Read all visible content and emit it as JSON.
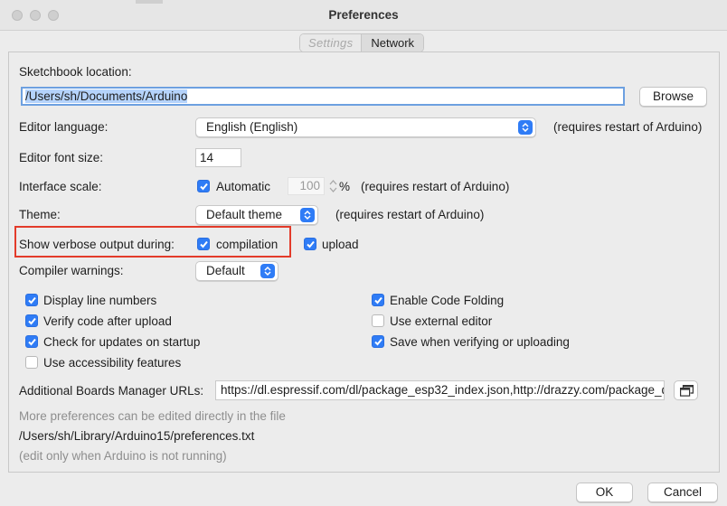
{
  "window": {
    "title": "Preferences"
  },
  "tabs": [
    {
      "label": "Settings",
      "active": true
    },
    {
      "label": "Network",
      "active": false
    }
  ],
  "sketchbook": {
    "label": "Sketchbook location:",
    "path": "/Users/sh/Documents/Arduino",
    "browse_label": "Browse"
  },
  "editor_language": {
    "label": "Editor language:",
    "value": "English (English)",
    "note": "(requires restart of Arduino)"
  },
  "editor_font_size": {
    "label": "Editor font size:",
    "value": "14"
  },
  "interface_scale": {
    "label": "Interface scale:",
    "automatic_label": "Automatic",
    "automatic_checked": true,
    "value": "100",
    "unit": "%",
    "note": "(requires restart of Arduino)"
  },
  "theme": {
    "label": "Theme:",
    "value": "Default theme",
    "note": "(requires restart of Arduino)"
  },
  "verbose": {
    "label": "Show verbose output during:",
    "compilation_label": "compilation",
    "compilation_checked": true,
    "upload_label": "upload",
    "upload_checked": true
  },
  "compiler_warnings": {
    "label": "Compiler warnings:",
    "value": "Default"
  },
  "options": {
    "display_line_numbers": {
      "label": "Display line numbers",
      "checked": true
    },
    "verify_after_upload": {
      "label": "Verify code after upload",
      "checked": true
    },
    "check_updates": {
      "label": "Check for updates on startup",
      "checked": true
    },
    "accessibility": {
      "label": "Use accessibility features",
      "checked": false
    },
    "code_folding": {
      "label": "Enable Code Folding",
      "checked": true
    },
    "external_editor": {
      "label": "Use external editor",
      "checked": false
    },
    "save_on_verify": {
      "label": "Save when verifying or uploading",
      "checked": true
    }
  },
  "boards_manager": {
    "label": "Additional Boards Manager URLs:",
    "value": "https://dl.espressif.com/dl/package_esp32_index.json,http://drazzy.com/package_drazzy.com_index.json"
  },
  "footer": {
    "more_prefs": "More preferences can be edited directly in the file",
    "prefs_path": "/Users/sh/Library/Arduino15/preferences.txt",
    "edit_note": "(edit only when Arduino is not running)"
  },
  "buttons": {
    "ok": "OK",
    "cancel": "Cancel"
  },
  "colors": {
    "accent": "#2f7cf6",
    "highlight_border": "#e33b2a",
    "selection": "#b5d3fb"
  }
}
